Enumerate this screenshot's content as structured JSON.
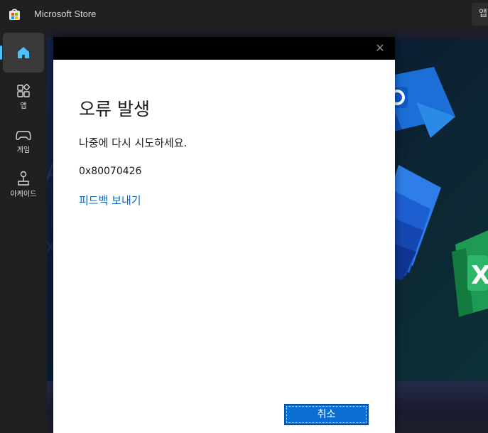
{
  "app": {
    "title": "Microsoft Store",
    "top_right_label": "앱"
  },
  "sidebar": {
    "items": [
      {
        "id": "home",
        "label": "",
        "icon": "home-icon",
        "active": true
      },
      {
        "id": "apps",
        "label": "앱",
        "icon": "apps-icon"
      },
      {
        "id": "games",
        "label": "게임",
        "icon": "gamepad-icon"
      },
      {
        "id": "arcade",
        "label": "아케이드",
        "icon": "joystick-icon"
      }
    ]
  },
  "dialog": {
    "title": "오류 발생",
    "message": "나중에 다시 시도하세요.",
    "error_code": "0x80070426",
    "feedback_link": "피드백 보내기",
    "cancel_label": "취소",
    "close_glyph": "✕"
  },
  "colors": {
    "accent": "#4cc2ff",
    "link": "#0a66c2",
    "button": "#0a6fd1",
    "dialog_bar": "#000000"
  }
}
